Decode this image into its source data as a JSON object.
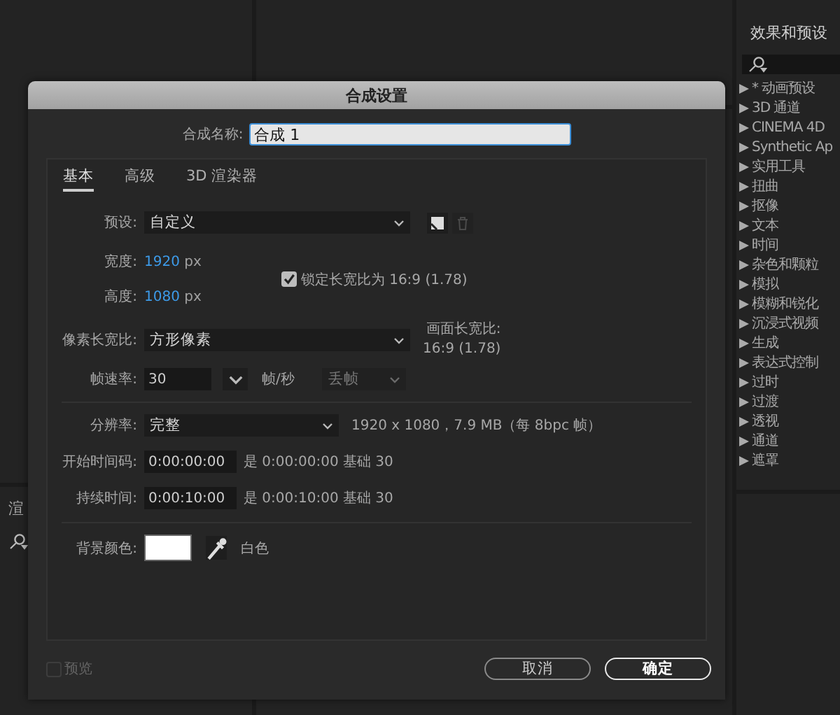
{
  "workspace": {
    "left_tab": "渲"
  },
  "effects_panel": {
    "title": "效果和预设",
    "items": [
      {
        "label": "* 动画预设"
      },
      {
        "label": "3D 通道"
      },
      {
        "label": "CINEMA 4D"
      },
      {
        "label": "Synthetic Ap"
      },
      {
        "label": "实用工具"
      },
      {
        "label": "扭曲"
      },
      {
        "label": "抠像"
      },
      {
        "label": "文本"
      },
      {
        "label": "时间"
      },
      {
        "label": "杂色和颗粒"
      },
      {
        "label": "模拟"
      },
      {
        "label": "模糊和锐化"
      },
      {
        "label": "沉浸式视频"
      },
      {
        "label": "生成"
      },
      {
        "label": "表达式控制"
      },
      {
        "label": "过时"
      },
      {
        "label": "过渡"
      },
      {
        "label": "透视"
      },
      {
        "label": "通道"
      },
      {
        "label": "遮罩"
      }
    ]
  },
  "dialog": {
    "title": "合成设置",
    "name_label": "合成名称:",
    "name_value": "合成 1",
    "tabs": [
      {
        "label": "基本",
        "selected": true
      },
      {
        "label": "高级",
        "selected": false
      },
      {
        "label": "3D 渲染器",
        "selected": false
      }
    ],
    "preset": {
      "label": "预设:",
      "value": "自定义"
    },
    "width": {
      "label": "宽度:",
      "value": "1920",
      "unit": "px"
    },
    "height": {
      "label": "高度:",
      "value": "1080",
      "unit": "px"
    },
    "lock_aspect": {
      "label": "锁定长宽比为 16:9 (1.78)",
      "checked": true
    },
    "pixel_aspect": {
      "label": "像素长宽比:",
      "value": "方形像素"
    },
    "frame_aspect": {
      "label": "画面长宽比:",
      "value": "16:9 (1.78)"
    },
    "frame_rate": {
      "label": "帧速率:",
      "value": "30",
      "unit": "帧/秒",
      "drop_frame": {
        "value": "丢帧",
        "disabled": true
      }
    },
    "resolution": {
      "label": "分辨率:",
      "value": "完整",
      "info": "1920 x 1080，7.9 MB（每 8bpc 帧）"
    },
    "start_timecode": {
      "label": "开始时间码:",
      "value": "0:00:00:00",
      "info": "是 0:00:00:00 基础 30"
    },
    "duration": {
      "label": "持续时间:",
      "value": "0:00:10:00",
      "info": "是 0:00:10:00 基础 30"
    },
    "background_color": {
      "label": "背景颜色:",
      "color": "#ffffff",
      "name": "白色"
    },
    "preview": {
      "label": "预览",
      "checked": false,
      "disabled": true
    },
    "buttons": [
      {
        "label": "取消",
        "kind": "cancel"
      },
      {
        "label": "确定",
        "kind": "default"
      }
    ]
  }
}
